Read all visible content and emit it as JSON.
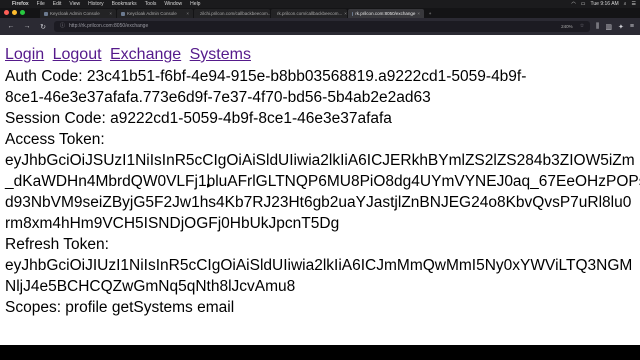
{
  "menubar": {
    "items": [
      "Firefox",
      "File",
      "Edit",
      "View",
      "History",
      "Bookmarks",
      "Tools",
      "Window",
      "Help"
    ],
    "clock": "Tue 9:16 AM"
  },
  "tabs": [
    {
      "label": "Keycloak Admin Console",
      "active": false
    },
    {
      "label": "Keycloak Admin Console",
      "active": false
    },
    {
      "label": "zilchi.prilcon.com/callbackbeecom...",
      "active": false
    },
    {
      "label": "rk.prilcon.com/callbackbeecom...",
      "active": false
    },
    {
      "label": "rk.prilcon.com:8050/exchange",
      "active": true
    }
  ],
  "navbar": {
    "url": "http://rk.prilcon.com:8050/exchange",
    "zoom": "240%"
  },
  "page": {
    "links": {
      "login": "Login",
      "logout": "Logout",
      "exchange": "Exchange",
      "systems": "Systems"
    },
    "auth_code_line1": "Auth Code: 23c41b51-f6bf-4e94-915e-b8bb03568819.a9222cd1-5059-4b9f-",
    "auth_code_line2": "8ce1-46e3e37afafa.773e6d9f-7e37-4f70-bd56-5b4ab2e2ad63",
    "session_code": "Session Code:  a9222cd1-5059-4b9f-8ce1-46e3e37afafa",
    "access_token_label": "Access Token:",
    "access_token_line1": "eyJhbGciOiJSUzI1NiIsInR5cCIgOiAiSldUIiwia2lkIiA6ICJERkhBYmlZS2lZS284b3ZIOW5iZm",
    "access_token_line2": "_dKaWDHn4MbrdQW0VLFj1bluAFrlGLTNQP6MU8PiO8dg4UYmVYNEJ0aq_67EeOHzPOPs",
    "access_token_line3": "d93NbVM9seiZByjG5F2Jw1hs4Kb7RJ23Ht6gb2uaYJastjlZnBNJEG24o8KbvQvsP7uRl8lu0",
    "access_token_line4": "rm8xm4hHm9VCH5ISNDjOGFj0HbUkJpcnT5Dg",
    "refresh_token_label": "Refresh Token:",
    "refresh_token_line1": "eyJhbGciOiJIUzI1NiIsInR5cCIgOiAiSldUIiwia2lkIiA6ICJmMmQwMmI5Ny0xYWViLTQ3NGM",
    "refresh_token_line2": "NljJ4e5BCHCQZwGmNq5qNth8lJcvAmu8",
    "scopes": "Scopes:  profile getSystems email"
  },
  "colors": {
    "link": "#551a8b",
    "browser_chrome": "#2b2a33",
    "menubar": "#1b1b1d"
  }
}
